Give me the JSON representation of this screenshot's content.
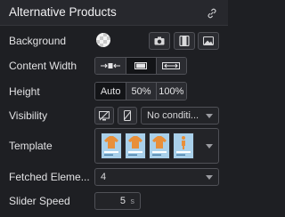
{
  "panel": {
    "title": "Alternative Products",
    "link_icon": "link-icon"
  },
  "background": {
    "label": "Background",
    "icons": [
      "no-color-swatch-icon",
      "camera-icon",
      "film-icon",
      "image-icon"
    ]
  },
  "content_width": {
    "label": "Content Width",
    "options": [
      "shrink-icon",
      "fit-icon",
      "expand-icon"
    ],
    "selected_index": 1
  },
  "height": {
    "label": "Height",
    "options": [
      "Auto",
      "50%",
      "100%"
    ],
    "selected": "Auto"
  },
  "visibility": {
    "label": "Visibility",
    "icons": [
      "hide-desktop-icon",
      "hide-mobile-icon"
    ],
    "select_value": "No conditi..."
  },
  "template": {
    "label": "Template",
    "thumbnails": [
      "tshirt-thumbnail",
      "tshirt-thumbnail",
      "tshirt-thumbnail",
      "figure-thumbnail"
    ]
  },
  "fetched_elements": {
    "label": "Fetched Eleme...",
    "value": "4"
  },
  "slider_speed": {
    "label": "Slider Speed",
    "value": "5",
    "unit": "s"
  },
  "colors": {
    "background": "#1e1f23",
    "header": "#27282d",
    "thumbnail": "#a9d0ea",
    "shirt": "#e88f3a"
  }
}
